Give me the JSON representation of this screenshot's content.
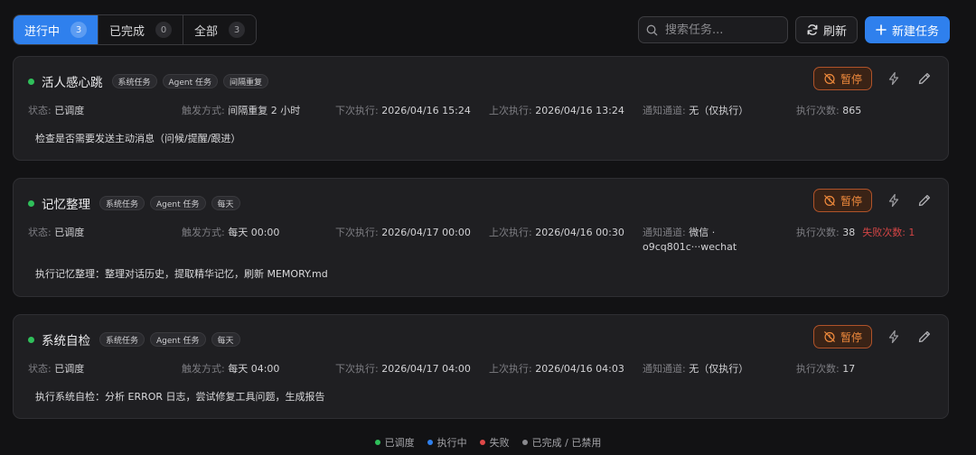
{
  "tabs": [
    {
      "label": "进行中",
      "count": "3"
    },
    {
      "label": "已完成",
      "count": "0"
    },
    {
      "label": "全部",
      "count": "3"
    }
  ],
  "search": {
    "placeholder": "搜索任务..."
  },
  "toolbar": {
    "refresh_label": "刷新",
    "new_label": "新建任务"
  },
  "labels": {
    "status": "状态:",
    "trigger": "触发方式:",
    "next_run": "下次执行:",
    "last_run": "上次执行:",
    "channel": "通知通道:",
    "run_count": "执行次数:",
    "pause": "暂停"
  },
  "tasks": [
    {
      "title": "活人感心跳",
      "tags": [
        "系统任务",
        "Agent 任务",
        "间隔重复"
      ],
      "status": "已调度",
      "trigger": "间隔重复 2 小时",
      "next_run": "2026/04/16 15:24",
      "last_run": "2026/04/16 13:24",
      "channel": "无（仅执行）",
      "run_count": "865",
      "description": "检查是否需要发送主动消息（问候/提醒/跟进）"
    },
    {
      "title": "记忆整理",
      "tags": [
        "系统任务",
        "Agent 任务",
        "每天"
      ],
      "status": "已调度",
      "trigger": "每天 00:00",
      "next_run": "2026/04/17 00:00",
      "last_run": "2026/04/16 00:30",
      "channel": "微信 ·",
      "channel_line2": "o9cq801c···wechat",
      "run_count": "38",
      "fail_label": "失败次数: 1",
      "description": "执行记忆整理：整理对话历史，提取精华记忆，刷新 MEMORY.md"
    },
    {
      "title": "系统自检",
      "tags": [
        "系统任务",
        "Agent 任务",
        "每天"
      ],
      "status": "已调度",
      "trigger": "每天 04:00",
      "next_run": "2026/04/17 04:00",
      "last_run": "2026/04/16 04:03",
      "channel": "无（仅执行）",
      "run_count": "17",
      "description": "执行系统自检：分析 ERROR 日志，尝试修复工具问题，生成报告"
    }
  ],
  "legend": [
    {
      "label": "已调度",
      "color": "#2fbf5a"
    },
    {
      "label": "执行中",
      "color": "#2f80ed"
    },
    {
      "label": "失败",
      "color": "#e04848"
    },
    {
      "label": "已完成 / 已禁用",
      "color": "#8a8a8e"
    }
  ],
  "colors": {
    "accent": "#2f80ed",
    "scheduled": "#2fbf5a",
    "pause": "#f08a3c",
    "fail": "#d24545"
  }
}
